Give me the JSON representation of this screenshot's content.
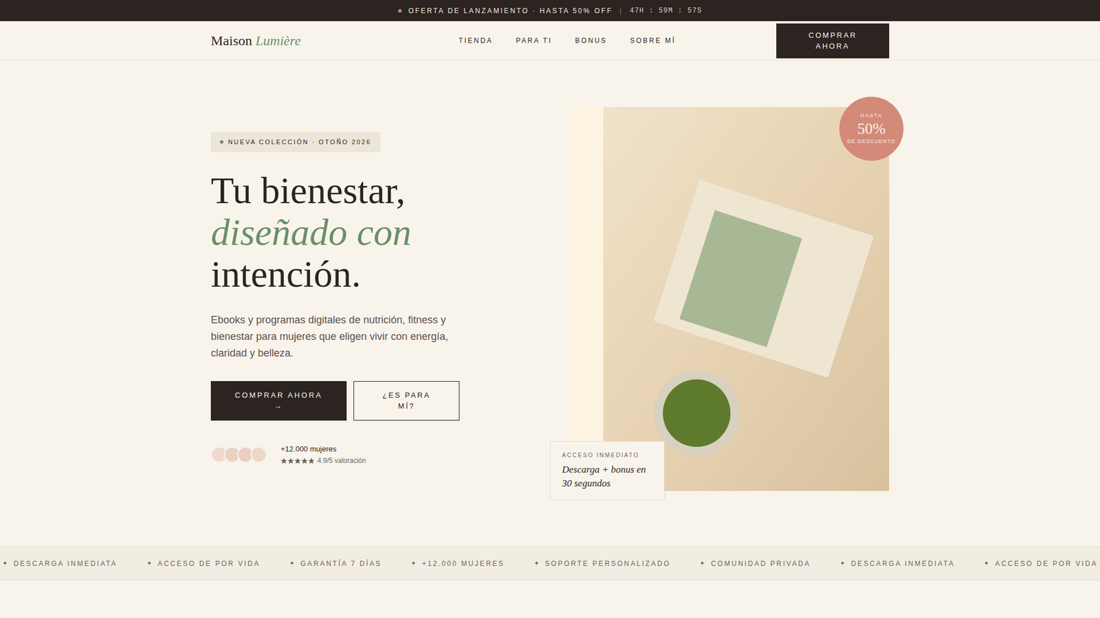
{
  "announcement": {
    "text": "OFERTA DE LANZAMIENTO · HASTA 50% OFF",
    "separator": "|",
    "countdown": "47H : 59M : 57S"
  },
  "header": {
    "logo": {
      "first": "Maison",
      "accent": "Lumière"
    },
    "nav": [
      {
        "label": "TIENDA"
      },
      {
        "label": "PARA TI"
      },
      {
        "label": "BONUS"
      },
      {
        "label": "SOBRE MÍ"
      }
    ],
    "cta": "COMPRAR AHORA"
  },
  "hero": {
    "badge": "NUEVA COLECCIÓN · OTOÑO 2026",
    "title": {
      "line1": "Tu bienestar,",
      "accent": "diseñado con",
      "line3": "intención."
    },
    "description": "Ebooks y programas digitales de nutrición, fitness y bienestar para mujeres que eligen vivir con energía, claridad y belleza.",
    "buttons": {
      "primary": "COMPRAR AHORA →",
      "secondary": "¿ES PARA MÍ?"
    },
    "social": {
      "count": "+12.000 mujeres",
      "stars": 5,
      "rating": "4.9/5 valoración"
    },
    "discount": {
      "top": "HASTA",
      "value": "50%",
      "bottom": "DE DESCUENTO"
    },
    "access": {
      "label": "ACCESO INMEDIATO",
      "text": "Descarga + bonus en 30 segundos"
    }
  },
  "marquee": {
    "icon": "✦",
    "items": [
      "DESCARGA INMEDIATA",
      "ACCESO DE POR VIDA",
      "GARANTÍA 7 DÍAS",
      "+12.000 MUJERES",
      "SOPORTE PERSONALIZADO",
      "COMUNIDAD PRIVADA",
      "DESCARGA INMEDIATA",
      "ACCESO DE POR VIDA"
    ]
  }
}
